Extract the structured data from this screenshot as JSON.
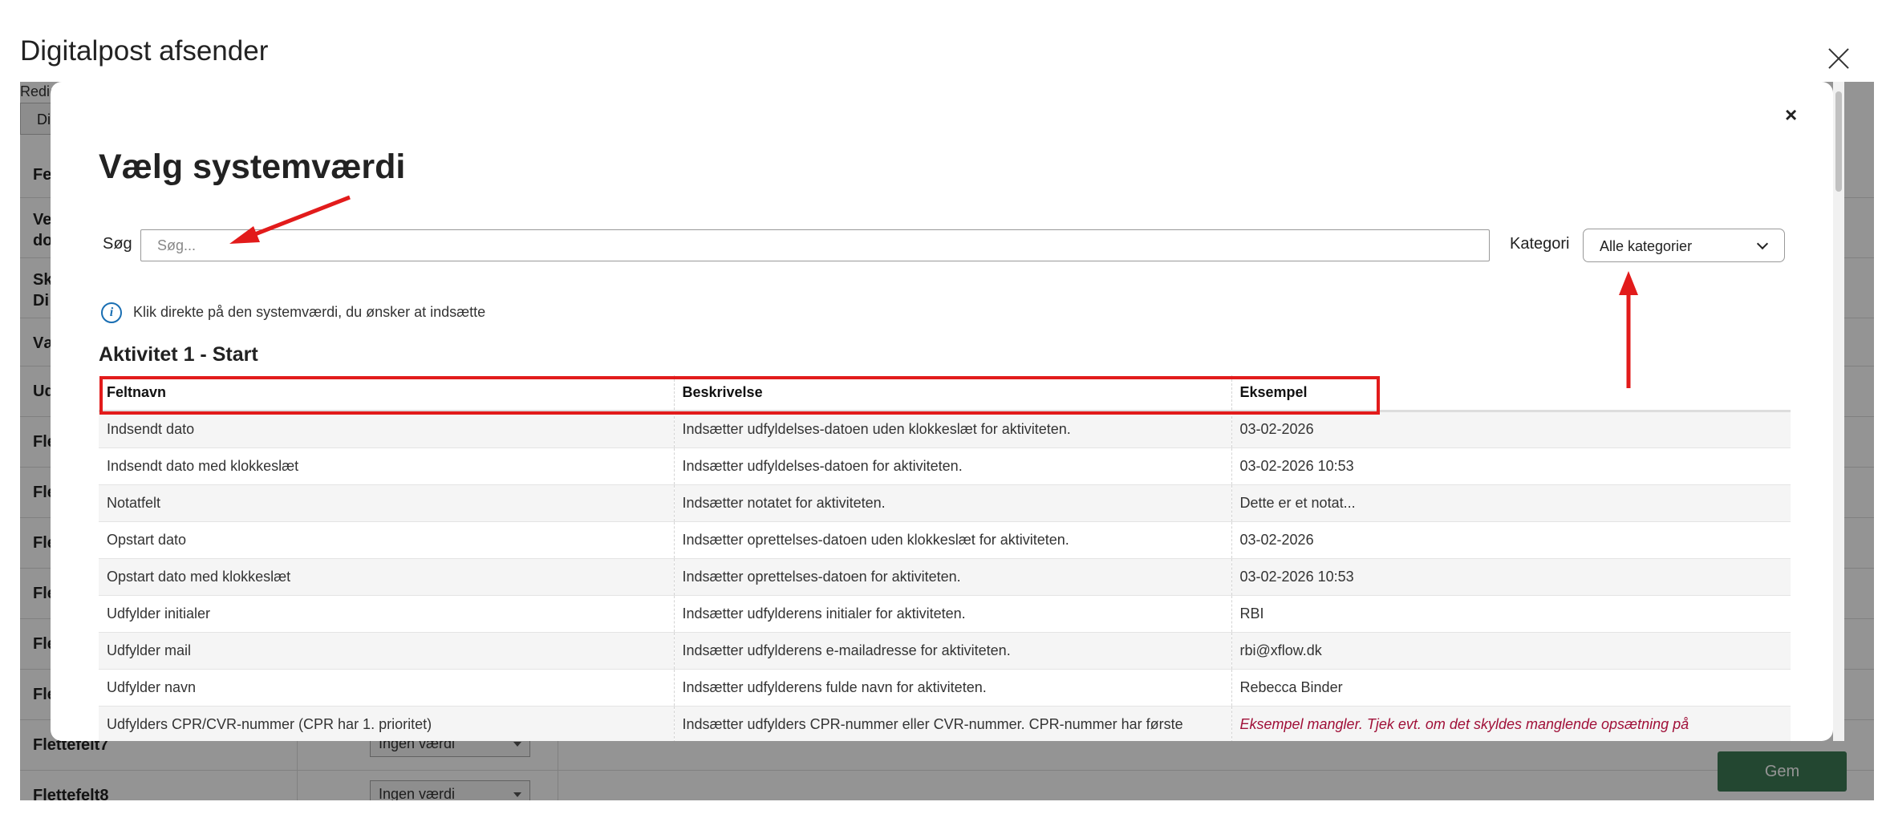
{
  "page": {
    "title": "Digitalpost afsender",
    "edit_label": "Redig",
    "tab_label": "Di",
    "rows": [
      {
        "label": "Felt"
      },
      {
        "label": "Ve"
      },
      {
        "label": "Sk"
      },
      {
        "label": "Væ"
      },
      {
        "label": "Ud"
      },
      {
        "label": "Fle"
      },
      {
        "label": "Fle"
      },
      {
        "label": "Fle"
      },
      {
        "label": "Fle"
      },
      {
        "label": "Fle"
      },
      {
        "label": "Fle"
      },
      {
        "label": "Flettefelt7",
        "select": "Ingen værdi"
      },
      {
        "label": "Flettefelt8",
        "select": "Ingen værdi"
      }
    ],
    "row_extra": {
      "ve2": "do",
      "sk2": "Di"
    },
    "save_label": "Gem"
  },
  "modal": {
    "close_label": "×",
    "title": "Vælg systemværdi",
    "search": {
      "label": "Søg",
      "placeholder": "Søg..."
    },
    "category": {
      "label": "Kategori",
      "selected": "Alle kategorier"
    },
    "info_icon": "i",
    "info_text": "Klik direkte på den systemværdi, du ønsker at indsætte",
    "section_heading": "Aktivitet 1 - Start",
    "table": {
      "headers": [
        "Feltnavn",
        "Beskrivelse",
        "Eksempel"
      ],
      "rows": [
        [
          "Indsendt dato",
          "Indsætter udfyldelses-datoen uden klokkeslæt for aktiviteten.",
          "03-02-2026"
        ],
        [
          "Indsendt dato med klokkeslæt",
          "Indsætter udfyldelses-datoen for aktiviteten.",
          "03-02-2026 10:53"
        ],
        [
          "Notatfelt",
          "Indsætter notatet for aktiviteten.",
          "Dette er et notat..."
        ],
        [
          "Opstart dato",
          "Indsætter oprettelses-datoen uden klokkeslæt for aktiviteten.",
          "03-02-2026"
        ],
        [
          "Opstart dato med klokkeslæt",
          "Indsætter oprettelses-datoen for aktiviteten.",
          "03-02-2026 10:53"
        ],
        [
          "Udfylder initialer",
          "Indsætter udfylderens initialer for aktiviteten.",
          "RBI"
        ],
        [
          "Udfylder mail",
          "Indsætter udfylderens e-mailadresse for aktiviteten.",
          "rbi@xflow.dk"
        ],
        [
          "Udfylder navn",
          "Indsætter udfylderens fulde navn for aktiviteten.",
          "Rebecca Binder"
        ],
        [
          "Udfylders CPR/CVR-nummer (CPR har 1. prioritet)",
          "Indsætter udfylders CPR-nummer eller CVR-nummer. CPR-nummer har første",
          "Eksempel mangler. Tjek evt. om det skyldes manglende opsætning på"
        ]
      ]
    }
  },
  "colors": {
    "annotation_red": "#e21b1b",
    "save_green": "#3d7a55",
    "info_blue": "#1a6fb3",
    "missing_text": "#a01038"
  }
}
